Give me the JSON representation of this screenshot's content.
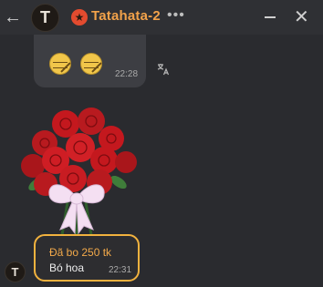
{
  "header": {
    "avatar_letter": "T",
    "chat_name": "Tatahata-2",
    "more_label": "•••",
    "close_label": "✕",
    "back_label": "←"
  },
  "messages": {
    "top": {
      "time": "22:28"
    },
    "gift": {
      "avatar_letter": "T",
      "title": "Đã bo 250 tk",
      "name": "Bó hoa",
      "time": "22:31"
    }
  },
  "icons": {
    "translate": "translate-icon",
    "star": "star-icon"
  },
  "colors": {
    "accent": "#f2a24a",
    "gift_border": "#f2b23e",
    "background": "#2a2b2f"
  }
}
